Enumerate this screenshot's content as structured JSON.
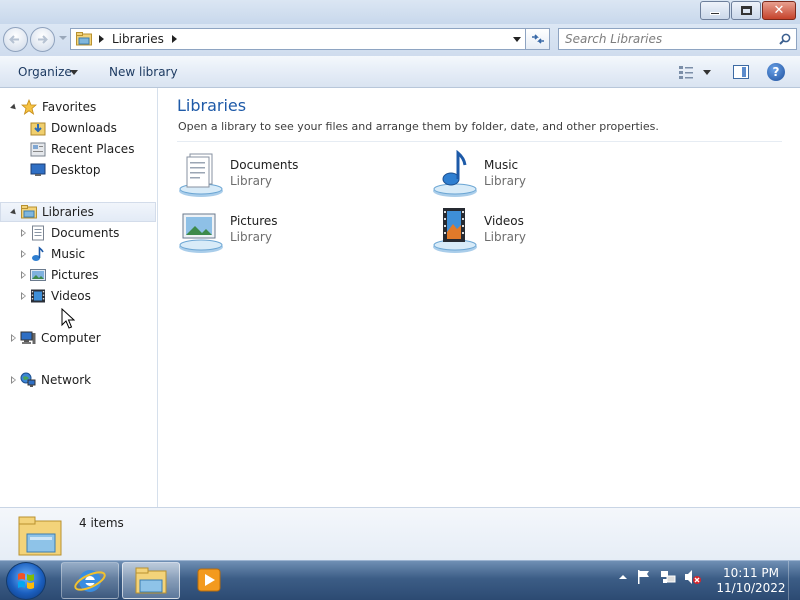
{
  "window": {
    "controls": {
      "minimize": "minimize",
      "maximize": "restore",
      "close": "close"
    }
  },
  "address_bar": {
    "crumbs": [
      "Libraries"
    ],
    "search_placeholder": "Search Libraries"
  },
  "toolbar": {
    "organize_label": "Organize",
    "new_library_label": "New library"
  },
  "nav_pane": {
    "favorites": {
      "label": "Favorites",
      "items": [
        {
          "label": "Downloads",
          "icon": "downloads-icon"
        },
        {
          "label": "Recent Places",
          "icon": "recent-places-icon"
        },
        {
          "label": "Desktop",
          "icon": "desktop-icon"
        }
      ]
    },
    "libraries": {
      "label": "Libraries",
      "selected": true,
      "items": [
        {
          "label": "Documents",
          "icon": "documents-icon"
        },
        {
          "label": "Music",
          "icon": "music-icon"
        },
        {
          "label": "Pictures",
          "icon": "pictures-icon"
        },
        {
          "label": "Videos",
          "icon": "videos-icon"
        }
      ]
    },
    "computer": {
      "label": "Computer"
    },
    "network": {
      "label": "Network"
    }
  },
  "content": {
    "title": "Libraries",
    "subtitle": "Open a library to see your files and arrange them by folder, date, and other properties.",
    "libraries": [
      {
        "name": "Documents",
        "kind": "Library",
        "icon": "documents-library-icon"
      },
      {
        "name": "Music",
        "kind": "Library",
        "icon": "music-library-icon"
      },
      {
        "name": "Pictures",
        "kind": "Library",
        "icon": "pictures-library-icon"
      },
      {
        "name": "Videos",
        "kind": "Library",
        "icon": "videos-library-icon"
      }
    ]
  },
  "status": {
    "item_count": "4 items"
  },
  "taskbar": {
    "time": "10:11 PM",
    "date": "11/10/2022"
  },
  "colors": {
    "title_blue": "#1e5aa8",
    "taskbar": "#3c5d86",
    "toolbar_text": "#1e3b62"
  }
}
